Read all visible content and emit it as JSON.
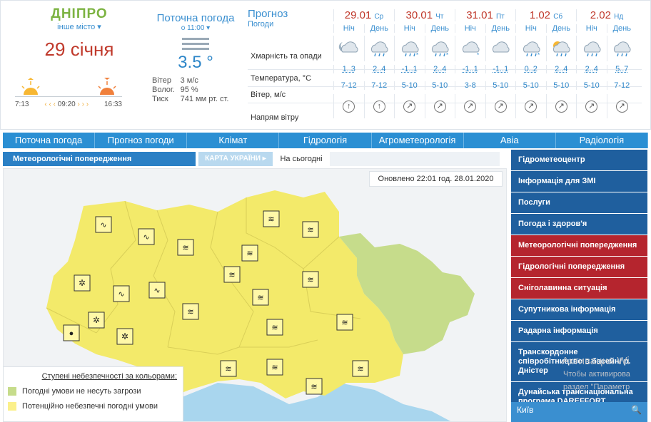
{
  "header": {
    "city": "ДНІПРО",
    "other_city": "інше місто",
    "date": "29 січня",
    "sunrise": "7:13",
    "noon": "09:20",
    "sunset": "16:33"
  },
  "current": {
    "title": "Поточна погода",
    "time": "о 11:00",
    "temp": "3.5 °",
    "wind_label": "Вітер",
    "wind_value": "3 м/с",
    "humidity_label": "Волог.",
    "humidity_value": "95 %",
    "pressure_label": "Тиск",
    "pressure_value": "741 мм рт. ст."
  },
  "forecast": {
    "title": "Прогноз",
    "subtitle": "Погоди",
    "labels": {
      "clouds": "Хмарність та опади",
      "temp": "Температура, °С",
      "wind": "Вітер, м/с",
      "direction": "Напрям вітру"
    },
    "days": [
      {
        "date": "29.01",
        "dow": "Ср"
      },
      {
        "date": "30.01",
        "dow": "Чт"
      },
      {
        "date": "31.01",
        "dow": "Пт"
      },
      {
        "date": "1.02",
        "dow": "Сб"
      },
      {
        "date": "2.02",
        "dow": "Нд"
      }
    ],
    "periods": [
      "Ніч",
      "День",
      "Ніч",
      "День",
      "Ніч",
      "День",
      "Ніч",
      "День",
      "Ніч",
      "День"
    ],
    "icons": [
      "moon-cloud-icon",
      "rain-cloud-icon",
      "snow-rain-icon",
      "snow-rain-icon",
      "snow-cloud-icon",
      "cloud-icon",
      "snow-rain-icon",
      "sun-cloud-rain-icon",
      "rain-cloud-icon",
      "rain-cloud-icon"
    ],
    "temps": [
      "1..3",
      "2..4",
      "-1..1",
      "2..4",
      "-1..1",
      "-1..1",
      "0..2",
      "2..4",
      "2..4",
      "5..7"
    ],
    "winds": [
      "7-12",
      "7-12",
      "5-10",
      "5-10",
      "3-8",
      "5-10",
      "5-10",
      "5-10",
      "5-10",
      "7-12"
    ],
    "dirs": [
      "↑",
      "↑",
      "↗",
      "↗",
      "↗",
      "↗",
      "↗",
      "↗",
      "↗",
      "↗"
    ]
  },
  "nav": [
    "Поточна погода",
    "Прогноз погоди",
    "Клімат",
    "Гідрологія",
    "Агрометеорологія",
    "Авіа",
    "Радіологія"
  ],
  "subnav": {
    "active": "Метеорологічні попередження",
    "map": "КАРТА УКРАЇНИ",
    "today": "На сьогодні"
  },
  "updated": "Оновлено 22:01 год. 28.01.2020",
  "legend": {
    "title": "Ступені небезпечності за кольорами:",
    "items": [
      {
        "label": "Погодні умови не несуть загрози",
        "color": "#c6dc8b"
      },
      {
        "label": "Потенційно небезпечні погодні умови",
        "color": "#fbf08a"
      }
    ]
  },
  "map_colors": {
    "yellow": "#f3ea6a",
    "green": "#c6dc8b",
    "sea": "#a9d6ee"
  },
  "sidebar": [
    {
      "label": "Гідрометеоцентр",
      "style": "blue"
    },
    {
      "label": "Інформація для ЗМІ",
      "style": "blue"
    },
    {
      "label": "Послуги",
      "style": "blue"
    },
    {
      "label": "Погода і здоров'я",
      "style": "blue"
    },
    {
      "label": "Метеорологічні попередження",
      "style": "red"
    },
    {
      "label": "Гідрологічні попередження",
      "style": "red"
    },
    {
      "label": "Сніголавинна ситуація",
      "style": "red"
    },
    {
      "label": "Супутникова інформація",
      "style": "blue"
    },
    {
      "label": "Радарна інформація",
      "style": "blue"
    },
    {
      "label": "Транскордонне співробітництво в басейні р. Дністер",
      "style": "blue"
    },
    {
      "label": "Дунайська транснаціональна програма DAREFFORT",
      "style": "blue"
    }
  ],
  "kyiv": "Київ",
  "watermark": {
    "line1": "Активация Wi",
    "line2": "Чтобы активирова",
    "line3": "раздел \"Параметр"
  }
}
